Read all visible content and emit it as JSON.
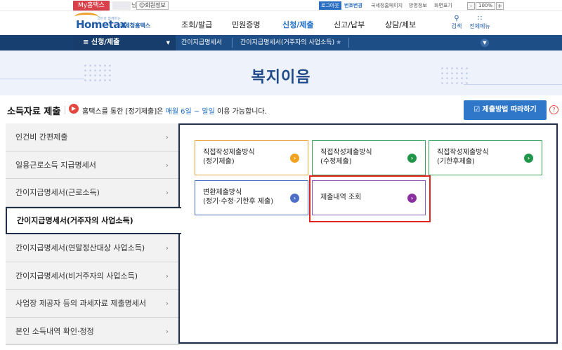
{
  "topbar": {
    "mytax_label": "My홈택스",
    "username_suffix": "님",
    "member_info_label": "회원정보",
    "logout_label": "로그아웃",
    "links": [
      "번호변경",
      "국세청홈페이지",
      "방명정보",
      "화면표기"
    ],
    "zoom_value": "100%",
    "zoom_minus": "-",
    "zoom_plus": "+"
  },
  "header": {
    "logo_slogan": "국민과 함께하는",
    "logo_main": "Hometax",
    "logo_sub": "국세청홈택스",
    "gnb": [
      "조회/발급",
      "민원증명",
      "신청/제출",
      "신고/납부",
      "상담/제보"
    ],
    "gnb_active": "신청/제출",
    "search_label": "검색",
    "allmenu_label": "전체메뉴"
  },
  "locbar": {
    "menu_label": "신청/제출",
    "crumbs": [
      "간이지급명세서",
      "간이지급명세서(거주자의 사업소득)"
    ]
  },
  "banner": {
    "title": "복지이음"
  },
  "section": {
    "title": "소득자료 제출",
    "notice_prefix": "홈택스를 통한 [정기제출]은",
    "notice_highlight": "매월 6일 ~ 말일",
    "notice_suffix": "이용 가능합니다.",
    "guide_button": "제출방법 따라하기",
    "help_label": "?"
  },
  "lnb": {
    "items": [
      "인건비 간편제출",
      "일용근로소득 지급명세서",
      "간이지급명세서(근로소득)",
      "간이지급명세서(거주자의 사업소득)",
      "간이지급명세서(연말정산대상 사업소득)",
      "간이지급명세서(비거주자의 사업소득)",
      "사업장 제공자 등의 과세자료 제출명세서",
      "본인 소득내역 확인·정정"
    ],
    "active_index": 3
  },
  "cards": [
    {
      "line1": "직접작성제출방식",
      "line2": "(정기제출)",
      "color": "#f0a21e"
    },
    {
      "line1": "직접작성제출방식",
      "line2": "(수정제출)",
      "color": "#21964a"
    },
    {
      "line1": "직접작성제출방식",
      "line2": "(기한후제출)",
      "color": "#21964a"
    },
    {
      "line1": "변환제출방식",
      "line2": "(정기·수정·기한후 제출)",
      "color": "#4e6fc6"
    },
    {
      "line1": "제출내역 조회",
      "line2": "",
      "color": "#8a2fa0"
    }
  ],
  "icons": {
    "notice": "speaker-icon",
    "arrow": "chevron-right-icon",
    "guide": "checklist-icon",
    "search": "search-icon",
    "allmenu": "grid-icon"
  },
  "colors": {
    "brand": "#1f5ba8",
    "accent": "#1e6fc7",
    "locbar": "#1e4e86",
    "highlight": "#e3231f"
  }
}
